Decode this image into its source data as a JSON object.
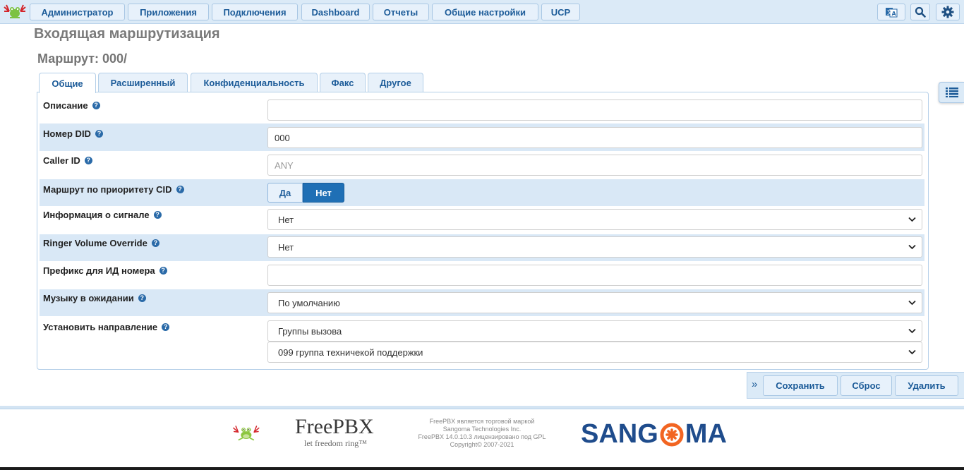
{
  "nav": {
    "items": [
      {
        "label": "Администратор"
      },
      {
        "label": "Приложения"
      },
      {
        "label": "Подключения"
      },
      {
        "label": "Dashboard"
      },
      {
        "label": "Отчеты"
      },
      {
        "label": "Общие настройки"
      },
      {
        "label": "UCP"
      }
    ],
    "icons": [
      "language-icon",
      "search-icon",
      "gear-icon"
    ]
  },
  "page": {
    "title": "Входящая маршрутизация",
    "route_title": "Маршрут: 000/"
  },
  "tabs": [
    {
      "label": "Общие",
      "active": true
    },
    {
      "label": "Расширенный",
      "active": false
    },
    {
      "label": "Конфиденциальность",
      "active": false
    },
    {
      "label": "Факс",
      "active": false
    },
    {
      "label": "Другое",
      "active": false
    }
  ],
  "form": {
    "description": {
      "label": "Описание",
      "value": ""
    },
    "did_number": {
      "label": "Номер DID",
      "value": "000"
    },
    "caller_id": {
      "label": "Caller ID",
      "value": "",
      "placeholder": "ANY"
    },
    "cid_priority": {
      "label": "Маршрут по приоритету CID",
      "yes_label": "Да",
      "no_label": "Нет",
      "selected": "Нет"
    },
    "alert_info": {
      "label": "Информация о сигнале",
      "value": "Нет"
    },
    "ringer_volume": {
      "label": "Ringer Volume Override",
      "value": "Нет"
    },
    "cid_prefix": {
      "label": "Префикс для ИД номера",
      "value": ""
    },
    "moh": {
      "label": "Музыку в ожидании",
      "value": "По умолчанию"
    },
    "destination": {
      "label": "Установить направление",
      "type_value": "Группы вызова",
      "target_value": "099 группа техничекой поддержки"
    }
  },
  "actions": {
    "save": "Сохранить",
    "reset": "Сброс",
    "delete": "Удалить"
  },
  "footer": {
    "freepbx_name": "FreePBX",
    "freepbx_tagline": "let freedom ring™",
    "text_lines": [
      "FreePBX является торговой маркой",
      "Sangoma Technologies Inc.",
      "FreePBX 14.0.10.3 лицензировано под GPL",
      "Copyright© 2007-2021"
    ],
    "sangoma_left": "SANG",
    "sangoma_right": "MA"
  },
  "colors": {
    "accent": "#1d5c99",
    "nav_bg": "#dbeaf7",
    "row_shade": "#d9e8f6",
    "toggle_active": "#1f6fb5",
    "sangoma_blue": "#1f4c8c",
    "sangoma_orange": "#f26522"
  }
}
